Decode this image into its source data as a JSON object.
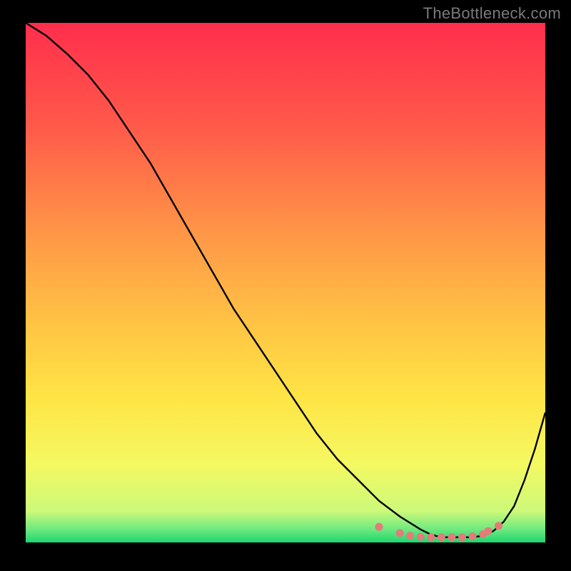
{
  "watermark": "TheBottleneck.com",
  "chart_data": {
    "type": "line",
    "title": "",
    "xlabel": "",
    "ylabel": "",
    "xlim": [
      0,
      100
    ],
    "ylim": [
      0,
      100
    ],
    "grid": false,
    "series": [
      {
        "name": "curve",
        "color": "#000000",
        "x": [
          0,
          4,
          8,
          12,
          16,
          20,
          24,
          28,
          32,
          36,
          40,
          44,
          48,
          52,
          56,
          60,
          64,
          68,
          72,
          76,
          78,
          80,
          82,
          84,
          86,
          88,
          90,
          92,
          94,
          96,
          98,
          100
        ],
        "y": [
          100,
          97.5,
          94,
          90,
          85,
          79,
          73,
          66,
          59,
          52,
          45,
          39,
          33,
          27,
          21,
          16,
          12,
          8,
          5,
          2.5,
          1.5,
          1,
          1,
          1,
          1,
          1.3,
          2.2,
          4,
          7,
          12,
          18,
          25
        ]
      }
    ],
    "markers": {
      "name": "bottom-markers",
      "color": "#e37b7b",
      "x": [
        68,
        72,
        74,
        76,
        78,
        80,
        82,
        84,
        86,
        88,
        89,
        91
      ],
      "y": [
        3.0,
        1.8,
        1.3,
        1.1,
        1.0,
        1.0,
        1.0,
        1.0,
        1.2,
        1.6,
        2.2,
        3.2
      ]
    },
    "background_gradient": {
      "stops": [
        {
          "offset": 0.0,
          "color": "#ff2e4c"
        },
        {
          "offset": 0.2,
          "color": "#ff5a4a"
        },
        {
          "offset": 0.4,
          "color": "#ff9547"
        },
        {
          "offset": 0.58,
          "color": "#ffc444"
        },
        {
          "offset": 0.72,
          "color": "#ffe445"
        },
        {
          "offset": 0.85,
          "color": "#f4f962"
        },
        {
          "offset": 0.94,
          "color": "#ccf97a"
        },
        {
          "offset": 0.975,
          "color": "#6de97f"
        },
        {
          "offset": 1.0,
          "color": "#1fd66f"
        }
      ]
    }
  }
}
